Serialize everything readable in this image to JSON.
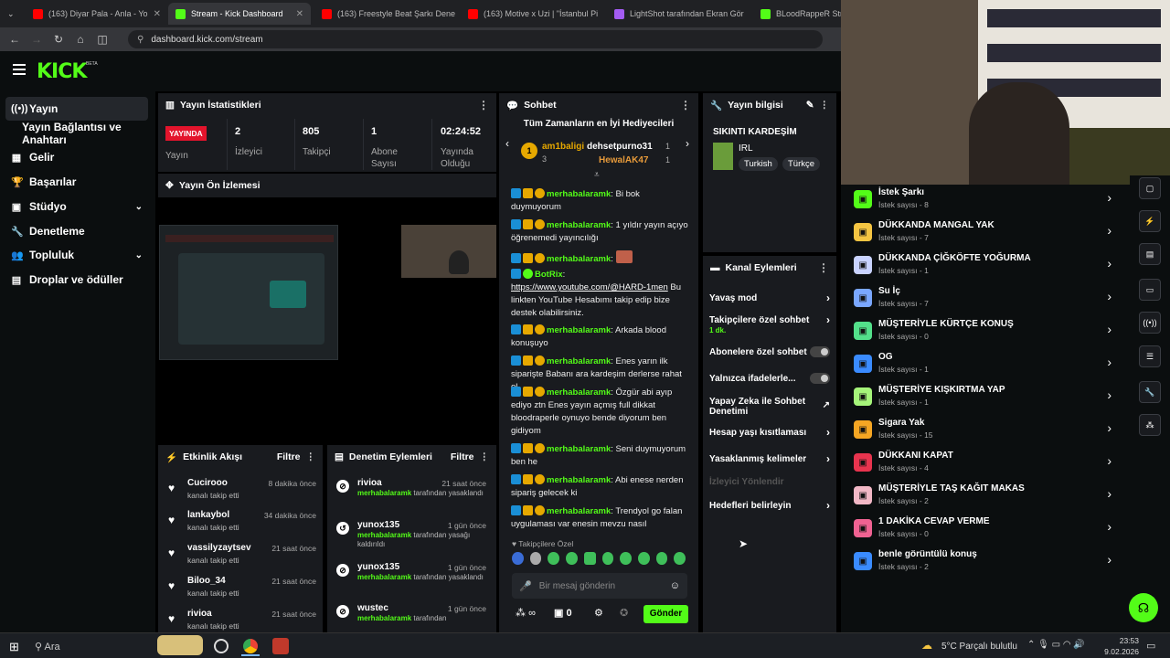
{
  "browser": {
    "tabs": [
      {
        "title": "(163) Diyar Pala - Anla - Yo",
        "color": "#ff0000"
      },
      {
        "title": "Stream - Kick Dashboard",
        "color": "#53fc18"
      },
      {
        "title": "(163) Freestyle Beat Şarkı Dene",
        "color": "#ff0000"
      },
      {
        "title": "(163) Motive x Uzi | \"İstanbul Pi",
        "color": "#ff0000"
      },
      {
        "title": "LightShot tarafından Ekran Gör",
        "color": "#a35cf2"
      },
      {
        "title": "BLoodRappeR Stream",
        "color": "#53fc18"
      }
    ],
    "url": "dashboard.kick.com/stream"
  },
  "logo": {
    "text": "KICK",
    "beta": "BETA"
  },
  "sidebar": {
    "items": [
      {
        "label": "Yayın",
        "icon": "broadcast-icon"
      },
      {
        "label": "Yayın Bağlantısı ve Anahtarı",
        "icon": ""
      },
      {
        "label": "Gelir",
        "icon": "revenue-icon"
      },
      {
        "label": "Başarılar",
        "icon": "trophy-icon"
      },
      {
        "label": "Stüdyo",
        "icon": "studio-icon"
      },
      {
        "label": "Denetleme",
        "icon": "wrench-icon"
      },
      {
        "label": "Topluluk",
        "icon": "community-icon"
      },
      {
        "label": "Droplar ve ödüller",
        "icon": "drops-icon"
      }
    ]
  },
  "stats": {
    "title": "Yayın İstatistikleri",
    "live_badge": "YAYINDA",
    "live_label": "Yayın",
    "viewers": "2",
    "viewers_label": "İzleyici",
    "followers": "805",
    "followers_label": "Takipçi",
    "subs": "1",
    "subs_label": "Abone Sayısı",
    "uptime": "02:24:52",
    "uptime_label": "Yayında Olduğu"
  },
  "preview": {
    "title": "Yayın Ön İzlemesi"
  },
  "activity": {
    "title": "Etkinlik Akışı",
    "filter": "Filtre",
    "items": [
      {
        "name": "Cucirooo",
        "action": "kanalı takip etti",
        "time": "8 dakika önce"
      },
      {
        "name": "lankaybol",
        "action": "kanalı takip etti",
        "time": "34 dakika önce"
      },
      {
        "name": "vassilyzaytsev",
        "action": "kanalı takip etti",
        "time": "21 saat önce"
      },
      {
        "name": "Biloo_34",
        "action": "kanalı takip etti",
        "time": "21 saat önce"
      },
      {
        "name": "rivioa",
        "action": "kanalı takip etti",
        "time": "21 saat önce"
      }
    ]
  },
  "moderation": {
    "title": "Denetim Eylemleri",
    "filter": "Filtre",
    "items": [
      {
        "name": "rivioa",
        "by": "merhabalaramk",
        "action": "tarafından yasaklandı",
        "time": "21 saat önce"
      },
      {
        "name": "yunox135",
        "by": "merhabalaramk",
        "action": "tarafından yasağı kaldırıldı",
        "time": "1 gün önce"
      },
      {
        "name": "yunox135",
        "by": "merhabalaramk",
        "action": "tarafından yasaklandı",
        "time": "1 gün önce"
      },
      {
        "name": "wustec",
        "by": "merhabalaramk",
        "action": "tarafından",
        "time": "1 gün önce"
      }
    ]
  },
  "chat": {
    "title": "Sohbet",
    "gifters_title": "Tüm Zamanların en İyi Hediyecileri",
    "gifters": [
      {
        "name": "am1baligi",
        "count": "3",
        "rank": "1"
      },
      {
        "name": "dehsetpurno31",
        "count": "1"
      },
      {
        "name": "HewalAK47",
        "count": "1"
      }
    ],
    "messages": [
      {
        "user": "merhabalaramk",
        "text": "Bi bok duymuyorum"
      },
      {
        "user": "merhabalaramk",
        "text": "1 yıldır yayın açıyo öğrenemedi yayıncılığı"
      },
      {
        "user": "merhabalaramk",
        "text": ""
      },
      {
        "user": "BotRix",
        "link": "https://www.youtube.com/@HARD-1men",
        "text": " Bu linkten YouTube Hesabımı takip edip bize destek olabilirsiniz."
      },
      {
        "user": "merhabalaramk",
        "text": "Arkada blood konuşuyo"
      },
      {
        "user": "merhabalaramk",
        "text": "Enes yarın ilk siparişte Babanı ara kardeşim derlerse rahat ol"
      },
      {
        "user": "merhabalaramk",
        "text": "Özgür abi ayıp ediyo ztn Enes yayın açmış full dikkat bloodraperle oynuyo bende diyorum ben gidiyom"
      },
      {
        "user": "merhabalaramk",
        "text": "Seni duymuyorum ben he"
      },
      {
        "user": "merhabalaramk",
        "text": "Abi enese nerden sipariş gelecek ki"
      },
      {
        "user": "merhabalaramk",
        "text": "Trendyol go falan uygulaması var enesin mevzu nasıl"
      }
    ],
    "followers_only": "Takipçilere Özel",
    "placeholder": "Bir mesaj gönderin",
    "infinity": "∞",
    "points": "0",
    "send": "Gönder"
  },
  "info": {
    "title": "Yayın bilgisi",
    "stream_title": "SIKINTI KARDEŞİM",
    "category": "IRL",
    "tags": [
      "Turkish",
      "Türkçe"
    ]
  },
  "channel_actions": {
    "title": "Kanal Eylemleri",
    "items": [
      {
        "label": "Yavaş mod",
        "type": "arrow"
      },
      {
        "label": "Takipçilere özel sohbet",
        "sub": "1 dk.",
        "type": "arrow"
      },
      {
        "label": "Abonelere özel sohbet",
        "type": "toggle"
      },
      {
        "label": "Yalnızca ifadelerle...",
        "type": "toggle"
      },
      {
        "label": "Yapay Zeka ile Sohbet Denetimi",
        "type": "ext"
      },
      {
        "label": "Hesap yaşı kısıtlaması",
        "type": "arrow"
      },
      {
        "label": "Yasaklanmış kelimeler",
        "type": "arrow"
      },
      {
        "label": "İzleyici Yönlendir",
        "type": "disabled"
      },
      {
        "label": "Hedefleri belirleyin",
        "type": "arrow"
      }
    ]
  },
  "rewards": [
    {
      "title": "İstek Şarkı",
      "count": "İstek sayısı - 8",
      "color": "#53fc18"
    },
    {
      "title": "DÜKKANDA MANGAL YAK",
      "count": "İstek sayısı - 7",
      "color": "#f5c542"
    },
    {
      "title": "DÜKKANDA ÇİĞKÖFTE YOĞURMA",
      "count": "İstek sayısı - 1",
      "color": "#c9d3ff"
    },
    {
      "title": "Su İç",
      "count": "İstek sayısı - 7",
      "color": "#7aa7ff"
    },
    {
      "title": "MÜŞTERİYLE KÜRTÇE KONUŞ",
      "count": "İstek sayısı - 0",
      "color": "#53e08a"
    },
    {
      "title": "OG",
      "count": "İstek sayısı - 1",
      "color": "#3a8bff"
    },
    {
      "title": "MÜŞTERİYE KIŞKIRTMA YAP",
      "count": "İstek sayısı - 1",
      "color": "#a6f57a"
    },
    {
      "title": "Sigara Yak",
      "count": "İstek sayısı - 15",
      "color": "#f5a623"
    },
    {
      "title": "DÜKKANI KAPAT",
      "count": "İstek sayısı - 4",
      "color": "#e8344e"
    },
    {
      "title": "MÜŞTERİYLE TAŞ KAĞIT MAKAS",
      "count": "İstek sayısı - 2",
      "color": "#f2b8c6"
    },
    {
      "title": "1 DAKİKA CEVAP VERME",
      "count": "İstek sayısı - 0",
      "color": "#f06292"
    },
    {
      "title": "benle görüntülü konuş",
      "count": "İstek sayısı - 2",
      "color": "#3a8bff"
    }
  ],
  "taskbar": {
    "search": "Ara",
    "weather": "5°C  Parçalı bulutlu",
    "time": "23:53",
    "date": "9.02.2026"
  }
}
